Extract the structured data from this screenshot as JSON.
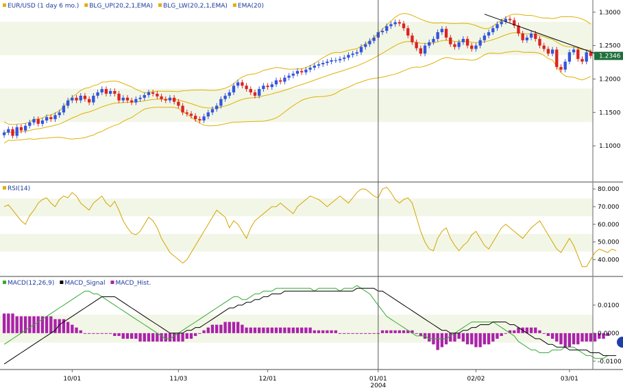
{
  "chart_data": [
    {
      "type": "candlestick",
      "legend": [
        {
          "label": "EUR/USD (1 day  6 mo.)",
          "color": "#e0b000"
        },
        {
          "label": "BLG_UP(20,2,1,EMA)",
          "color": "#e0b000"
        },
        {
          "label": "BLG_LW(20,2,1,EMA)",
          "color": "#e0b000"
        },
        {
          "label": "EMA(20)",
          "color": "#e0b000"
        }
      ],
      "ylim": [
        1.05,
        1.31
      ],
      "y_ticks": [
        "1.3000",
        "1.2500",
        "1.2000",
        "1.1500",
        "1.1000"
      ],
      "y_tick_values": [
        1.3,
        1.25,
        1.2,
        1.15,
        1.1
      ],
      "last_price": "1.2346",
      "colors": {
        "up": "#3355dd",
        "down": "#dd2222",
        "bands": "#e0b000",
        "trendline": "#000000"
      },
      "closes": [
        1.12,
        1.125,
        1.115,
        1.128,
        1.123,
        1.13,
        1.135,
        1.14,
        1.133,
        1.138,
        1.143,
        1.14,
        1.146,
        1.15,
        1.16,
        1.168,
        1.172,
        1.168,
        1.175,
        1.17,
        1.165,
        1.175,
        1.18,
        1.185,
        1.178,
        1.182,
        1.178,
        1.168,
        1.172,
        1.168,
        1.165,
        1.17,
        1.172,
        1.176,
        1.18,
        1.178,
        1.174,
        1.17,
        1.168,
        1.172,
        1.166,
        1.16,
        1.15,
        1.148,
        1.145,
        1.14,
        1.138,
        1.144,
        1.15,
        1.155,
        1.16,
        1.17,
        1.175,
        1.18,
        1.19,
        1.195,
        1.19,
        1.185,
        1.18,
        1.175,
        1.185,
        1.19,
        1.188,
        1.192,
        1.198,
        1.196,
        1.202,
        1.205,
        1.208,
        1.212,
        1.21,
        1.214,
        1.217,
        1.22,
        1.222,
        1.224,
        1.226,
        1.228,
        1.228,
        1.23,
        1.232,
        1.236,
        1.238,
        1.24,
        1.248,
        1.252,
        1.257,
        1.262,
        1.27,
        1.272,
        1.279,
        1.282,
        1.285,
        1.283,
        1.276,
        1.265,
        1.255,
        1.246,
        1.238,
        1.25,
        1.255,
        1.26,
        1.27,
        1.275,
        1.262,
        1.252,
        1.248,
        1.255,
        1.26,
        1.25,
        1.245,
        1.25,
        1.258,
        1.265,
        1.27,
        1.276,
        1.282,
        1.286,
        1.29,
        1.288,
        1.28,
        1.268,
        1.258,
        1.262,
        1.268,
        1.26,
        1.25,
        1.245,
        1.238,
        1.244,
        1.218,
        1.214,
        1.226,
        1.24,
        1.244,
        1.23,
        1.226,
        1.24,
        1.2346
      ],
      "trendline": {
        "from": {
          "i": 113,
          "v": 1.297
        },
        "to": {
          "i": 140,
          "v": 1.235
        }
      },
      "cursor_index": 88
    },
    {
      "type": "line",
      "legend": [
        {
          "label": "RSI(14)",
          "color": "#e0b000"
        }
      ],
      "ylim": [
        32,
        82
      ],
      "y_ticks": [
        "80.000",
        "70.000",
        "60.000",
        "50.000",
        "40.000"
      ],
      "y_tick_values": [
        80,
        70,
        60,
        50,
        40
      ],
      "series": [
        {
          "name": "RSI(14)",
          "color": "#d4a400",
          "values": [
            70,
            71,
            68,
            65,
            62,
            60,
            65,
            68,
            72,
            74,
            75,
            72,
            70,
            74,
            76,
            75,
            78,
            76,
            72,
            70,
            68,
            72,
            74,
            76,
            72,
            70,
            73,
            68,
            62,
            58,
            55,
            54,
            56,
            60,
            64,
            62,
            58,
            52,
            48,
            44,
            42,
            40,
            38,
            40,
            44,
            48,
            52,
            56,
            60,
            64,
            68,
            66,
            64,
            58,
            62,
            60,
            56,
            52,
            58,
            62,
            64,
            66,
            68,
            70,
            70,
            72,
            70,
            68,
            66,
            70,
            72,
            74,
            76,
            75,
            74,
            72,
            70,
            72,
            74,
            76,
            74,
            72,
            75,
            78,
            80,
            80,
            78,
            76,
            75,
            80,
            81,
            78,
            74,
            72,
            74,
            75,
            72,
            64,
            56,
            50,
            46,
            45,
            52,
            56,
            58,
            52,
            48,
            45,
            48,
            50,
            54,
            56,
            52,
            48,
            46,
            50,
            54,
            58,
            60,
            58,
            56,
            54,
            52,
            55,
            58,
            60,
            62,
            58,
            54,
            50,
            46,
            44,
            48,
            52,
            48,
            42,
            36,
            36,
            40,
            44,
            46,
            45,
            44,
            46,
            45
          ]
        }
      ]
    },
    {
      "type": "bar+line",
      "legend": [
        {
          "label": "MACD(12,26,9)",
          "color": "#33aa33"
        },
        {
          "label": "MACD_Signal",
          "color": "#000000"
        },
        {
          "label": "MACD_Hist.",
          "color": "#aa22aa"
        }
      ],
      "ylim": [
        -0.012,
        0.019
      ],
      "y_ticks": [
        "0.0100",
        "0.0000",
        "-0.0100"
      ],
      "y_tick_values": [
        0.01,
        0.0,
        -0.01
      ],
      "x_ticks": [
        {
          "label": "10/01",
          "i": 16
        },
        {
          "label": "11/03",
          "i": 41
        },
        {
          "label": "12/01",
          "i": 62
        },
        {
          "label": "01/01",
          "i": 88
        },
        {
          "label": "02/02",
          "i": 111
        },
        {
          "label": "03/01",
          "i": 133
        }
      ],
      "x_year_label": "2004",
      "series": [
        {
          "name": "MACD(12,26,9)",
          "color": "#33aa33",
          "values": [
            -0.004,
            -0.003,
            -0.002,
            -0.001,
            0.0,
            0.001,
            0.002,
            0.003,
            0.004,
            0.005,
            0.006,
            0.007,
            0.008,
            0.009,
            0.01,
            0.011,
            0.012,
            0.013,
            0.014,
            0.015,
            0.015,
            0.014,
            0.014,
            0.013,
            0.012,
            0.011,
            0.01,
            0.009,
            0.008,
            0.007,
            0.006,
            0.005,
            0.004,
            0.003,
            0.002,
            0.001,
            0.0,
            -0.001,
            -0.002,
            -0.002,
            -0.001,
            0.0,
            0.001,
            0.002,
            0.003,
            0.004,
            0.005,
            0.006,
            0.007,
            0.008,
            0.009,
            0.01,
            0.011,
            0.012,
            0.013,
            0.013,
            0.012,
            0.012,
            0.013,
            0.014,
            0.014,
            0.015,
            0.015,
            0.015,
            0.016,
            0.016,
            0.016,
            0.016,
            0.016,
            0.016,
            0.016,
            0.016,
            0.016,
            0.015,
            0.016,
            0.016,
            0.016,
            0.016,
            0.016,
            0.015,
            0.016,
            0.016,
            0.016,
            0.017,
            0.016,
            0.015,
            0.014,
            0.012,
            0.01,
            0.008,
            0.006,
            0.005,
            0.004,
            0.003,
            0.002,
            0.001,
            0.0,
            -0.001,
            -0.001,
            -0.001,
            -0.002,
            -0.002,
            -0.002,
            -0.002,
            -0.002,
            -0.001,
            0.0,
            0.001,
            0.002,
            0.003,
            0.004,
            0.004,
            0.004,
            0.004,
            0.004,
            0.004,
            0.003,
            0.002,
            0.001,
            0.0,
            -0.001,
            -0.003,
            -0.004,
            -0.005,
            -0.006,
            -0.006,
            -0.007,
            -0.007,
            -0.007,
            -0.006,
            -0.006,
            -0.006,
            -0.005,
            -0.005,
            -0.005,
            -0.006,
            -0.007,
            -0.008,
            -0.008,
            -0.009,
            -0.009,
            -0.009,
            -0.008
          ]
        },
        {
          "name": "MACD_Signal",
          "color": "#000000",
          "values": [
            -0.011,
            -0.01,
            -0.009,
            -0.008,
            -0.007,
            -0.006,
            -0.005,
            -0.004,
            -0.003,
            -0.002,
            -0.001,
            0.0,
            0.001,
            0.003,
            0.004,
            0.005,
            0.006,
            0.007,
            0.008,
            0.009,
            0.01,
            0.011,
            0.012,
            0.013,
            0.013,
            0.013,
            0.013,
            0.012,
            0.011,
            0.01,
            0.009,
            0.008,
            0.007,
            0.006,
            0.005,
            0.004,
            0.003,
            0.002,
            0.001,
            0.0,
            0.0,
            0.0,
            0.0,
            0.001,
            0.001,
            0.002,
            0.002,
            0.003,
            0.004,
            0.005,
            0.006,
            0.007,
            0.008,
            0.009,
            0.009,
            0.01,
            0.01,
            0.011,
            0.011,
            0.012,
            0.012,
            0.013,
            0.013,
            0.014,
            0.014,
            0.014,
            0.015,
            0.015,
            0.015,
            0.015,
            0.015,
            0.015,
            0.015,
            0.015,
            0.015,
            0.015,
            0.015,
            0.015,
            0.015,
            0.015,
            0.015,
            0.015,
            0.015,
            0.016,
            0.016,
            0.016,
            0.016,
            0.016,
            0.015,
            0.015,
            0.014,
            0.013,
            0.012,
            0.011,
            0.01,
            0.009,
            0.008,
            0.007,
            0.006,
            0.005,
            0.004,
            0.003,
            0.002,
            0.001,
            0.001,
            0.0,
            0.0,
            0.0,
            0.001,
            0.001,
            0.002,
            0.002,
            0.003,
            0.003,
            0.003,
            0.004,
            0.004,
            0.004,
            0.004,
            0.003,
            0.003,
            0.002,
            0.001,
            0.0,
            -0.001,
            -0.002,
            -0.002,
            -0.003,
            -0.004,
            -0.004,
            -0.005,
            -0.005,
            -0.005,
            -0.006,
            -0.006,
            -0.006,
            -0.006,
            -0.006,
            -0.007,
            -0.007,
            -0.007,
            -0.008,
            -0.008,
            -0.008,
            -0.008
          ]
        }
      ],
      "histogram": [
        0.007,
        0.007,
        0.007,
        0.006,
        0.006,
        0.006,
        0.006,
        0.006,
        0.006,
        0.006,
        0.006,
        0.006,
        0.005,
        0.005,
        0.005,
        0.004,
        0.003,
        0.002,
        0.001,
        0.0,
        0.0,
        0.0,
        0.0,
        0.0,
        0.0,
        0.0,
        -0.001,
        -0.001,
        -0.002,
        -0.002,
        -0.002,
        -0.002,
        -0.003,
        -0.003,
        -0.003,
        -0.003,
        -0.003,
        -0.003,
        -0.003,
        -0.003,
        -0.003,
        -0.003,
        -0.003,
        -0.002,
        -0.002,
        -0.001,
        0.0,
        0.001,
        0.002,
        0.003,
        0.003,
        0.003,
        0.004,
        0.004,
        0.004,
        0.004,
        0.003,
        0.002,
        0.002,
        0.002,
        0.002,
        0.002,
        0.002,
        0.002,
        0.002,
        0.002,
        0.002,
        0.002,
        0.002,
        0.002,
        0.002,
        0.002,
        0.002,
        0.001,
        0.001,
        0.001,
        0.001,
        0.001,
        0.001,
        0.0,
        0.0,
        0.0,
        0.0,
        0.0,
        0.0,
        0.0,
        0.0,
        0.0,
        0.0,
        0.001,
        0.001,
        0.001,
        0.001,
        0.001,
        0.001,
        0.001,
        0.001,
        0.0,
        -0.001,
        -0.002,
        -0.003,
        -0.004,
        -0.006,
        -0.005,
        -0.004,
        -0.003,
        -0.003,
        -0.002,
        -0.003,
        -0.004,
        -0.004,
        -0.005,
        -0.005,
        -0.004,
        -0.004,
        -0.003,
        -0.002,
        -0.001,
        0.0,
        0.001,
        0.001,
        0.002,
        0.002,
        0.002,
        0.002,
        0.002,
        0.001,
        0.0,
        -0.001,
        -0.002,
        -0.003,
        -0.004,
        -0.005,
        -0.005,
        -0.004,
        -0.004,
        -0.003,
        -0.003,
        -0.003,
        -0.003,
        -0.002,
        -0.002,
        -0.001
      ]
    }
  ]
}
